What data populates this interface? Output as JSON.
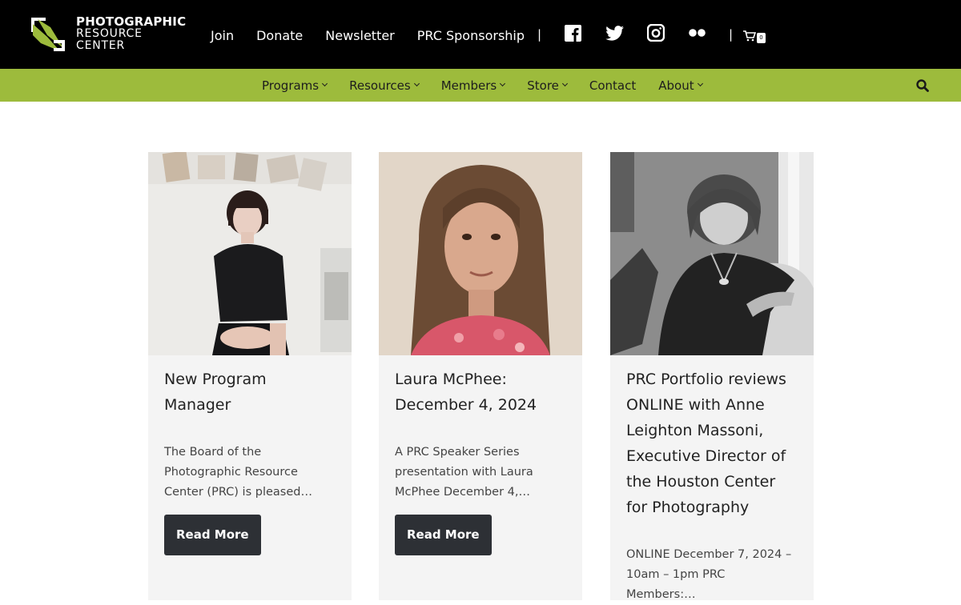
{
  "brand": {
    "line1": "PHOTOGRAPHIC",
    "line2": "RESOURCE",
    "line3": "CENTER",
    "accent_color": "#9dbb3c"
  },
  "top_links": [
    "Join",
    "Donate",
    "Newsletter",
    "PRC Sponsorship"
  ],
  "separator": "|",
  "social": [
    {
      "name": "facebook-icon"
    },
    {
      "name": "twitter-icon"
    },
    {
      "name": "instagram-icon"
    },
    {
      "name": "flickr-icon"
    }
  ],
  "cart": {
    "count": "0",
    "icon": "shopping-cart-icon"
  },
  "menu": [
    {
      "label": "Programs",
      "dropdown": true
    },
    {
      "label": "Resources",
      "dropdown": true
    },
    {
      "label": "Members",
      "dropdown": true
    },
    {
      "label": "Store",
      "dropdown": true
    },
    {
      "label": "Contact",
      "dropdown": false
    },
    {
      "label": "About",
      "dropdown": true
    }
  ],
  "search": {
    "icon": "search-icon"
  },
  "posts": [
    {
      "title": "New Program Manager",
      "excerpt": "The Board of the Photographic Resource Center (PRC) is pleased…",
      "button": "Read More"
    },
    {
      "title": "Laura McPhee: December 4, 2024",
      "excerpt": "A PRC Speaker Series presentation with Laura McPhee December 4,…",
      "button": "Read More"
    },
    {
      "title": "PRC Portfolio reviews ONLINE with Anne Leighton Massoni, Executive Director of the Houston Center for Photography",
      "excerpt": "ONLINE December 7, 2024 – 10am – 1pm PRC Members:…"
    }
  ]
}
